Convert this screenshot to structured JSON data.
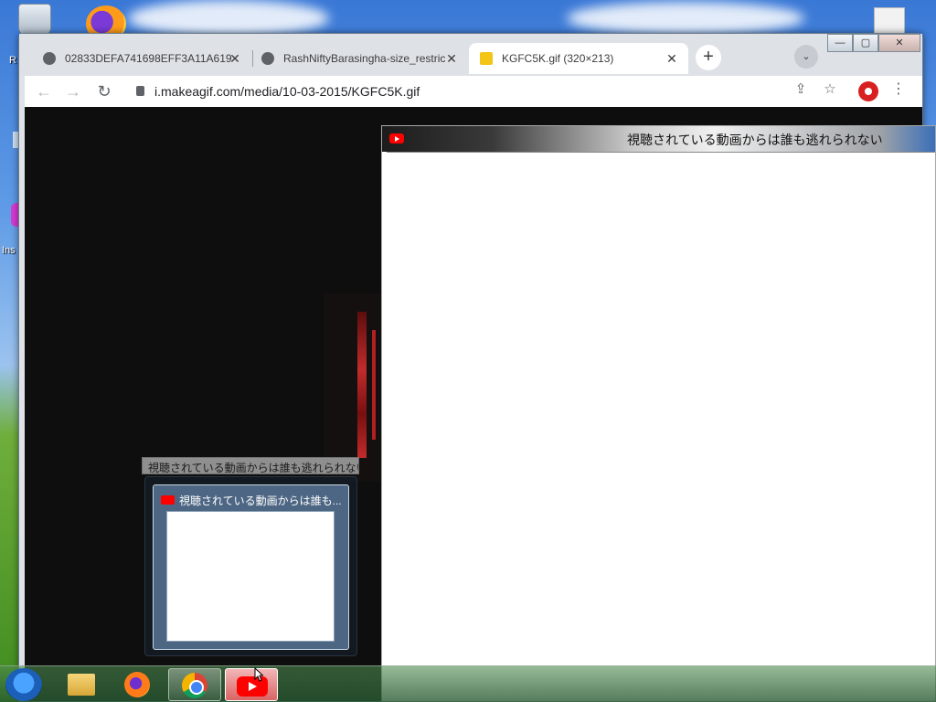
{
  "desktop": {
    "label_r": "R",
    "label_ins": "Ins"
  },
  "browser": {
    "tabs": [
      {
        "label": "02833DEFA741698EFF3A11A619",
        "active": false
      },
      {
        "label": "RashNiftyBarasingha-size_restric",
        "active": false
      },
      {
        "label": "KGFC5K.gif (320×213)",
        "active": true
      }
    ],
    "new_tab_label": "+",
    "tab_search_label": "⌄",
    "window_controls": {
      "minimize": "—",
      "maximize": "▢",
      "close": "✕"
    },
    "nav": {
      "back": "←",
      "forward": "→",
      "reload": "↻"
    },
    "url": "i.makeagif.com/media/10-03-2015/KGFC5K.gif",
    "toolbar_icons": {
      "share": "⇪",
      "bookmark": "☆",
      "menu": "⋮"
    }
  },
  "overlay_window": {
    "title": "視聴されている動画からは誰も逃れられない"
  },
  "taskbar": {
    "tooltip": "視聴されている動画からは誰も逃れられない",
    "thumbnail_title": "視聴されている動画からは誰も..."
  }
}
